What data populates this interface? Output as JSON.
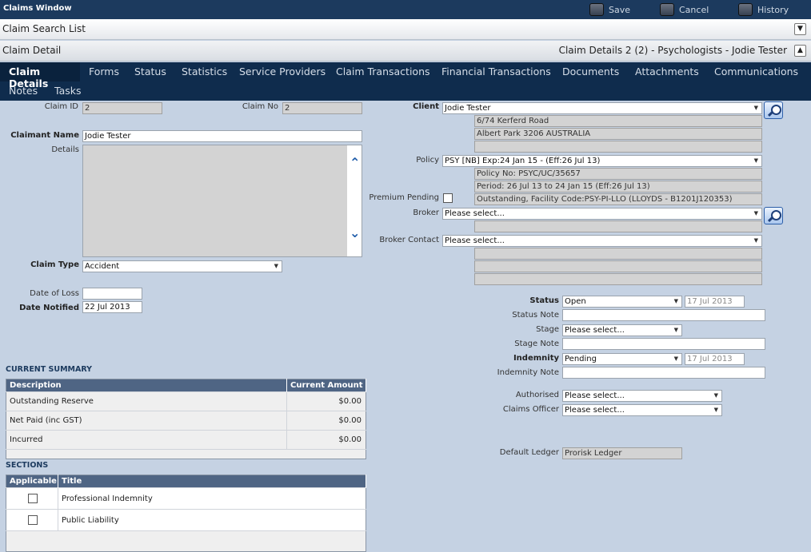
{
  "window": {
    "title": "Claims Window"
  },
  "toolbar": {
    "save": "Save",
    "cancel": "Cancel",
    "history": "History"
  },
  "search_bar": {
    "label": "Claim Search List"
  },
  "detail_bar": {
    "label": "Claim Detail",
    "summary": "Claim Details 2 (2) - Psychologists - Jodie Tester"
  },
  "tabs": [
    "Claim Details",
    "Forms",
    "Status",
    "Statistics",
    "Service Providers",
    "Claim Transactions",
    "Financial Transactions",
    "Documents",
    "Attachments",
    "Communications",
    "Notes",
    "Tasks"
  ],
  "form": {
    "claim_id_label": "Claim ID",
    "claim_id": "2",
    "claim_no_label": "Claim No",
    "claim_no": "2",
    "claimant_name_label": "Claimant Name",
    "claimant_name": "Jodie Tester",
    "details_label": "Details",
    "claim_type_label": "Claim Type",
    "claim_type": "Accident",
    "date_of_loss_label": "Date of Loss",
    "date_of_loss": "",
    "date_notified_label": "Date Notified",
    "date_notified": "22 Jul 2013",
    "client_label": "Client",
    "client": "Jodie Tester",
    "client_addr1": "6/74 Kerferd Road",
    "client_addr2": "Albert Park 3206 AUSTRALIA",
    "client_addr3": "",
    "policy_label": "Policy",
    "policy": "PSY [NB] Exp:24 Jan 15 -  (Eff:26 Jul 13)",
    "policy_no": "Policy No: PSYC/UC/35657",
    "policy_period": "Period: 26 Jul 13 to 24 Jan 15 (Eff:26 Jul 13)",
    "policy_status": "Outstanding, Facility Code:PSY-PI-LLO (LLOYDS - B1201J120353)",
    "premium_pending_label": "Premium Pending",
    "broker_label": "Broker",
    "broker": "Please select...",
    "broker_contact_label": "Broker Contact",
    "broker_contact": "Please select...",
    "status_label": "Status",
    "status": "Open",
    "status_date": "17 Jul 2013",
    "status_note_label": "Status Note",
    "stage_label": "Stage",
    "stage": "Please select...",
    "stage_note_label": "Stage Note",
    "indemnity_label": "Indemnity",
    "indemnity": "Pending",
    "indemnity_date": "17 Jul 2013",
    "indemnity_note_label": "Indemnity Note",
    "authorised_label": "Authorised",
    "authorised": "Please select...",
    "claims_officer_label": "Claims Officer",
    "claims_officer": "Please select...",
    "default_ledger_label": "Default Ledger",
    "default_ledger": "Prorisk Ledger"
  },
  "current_summary": {
    "title": "CURRENT SUMMARY",
    "headers": [
      "Description",
      "Current Amount"
    ],
    "rows": [
      {
        "description": "Outstanding Reserve",
        "amount": "$0.00"
      },
      {
        "description": "Net Paid (inc GST)",
        "amount": "$0.00"
      },
      {
        "description": "Incurred",
        "amount": "$0.00"
      }
    ]
  },
  "sections": {
    "title": "SECTIONS",
    "headers": [
      "Applicable",
      "Title"
    ],
    "rows": [
      {
        "title": "Professional Indemnity"
      },
      {
        "title": "Public Liability"
      }
    ]
  }
}
